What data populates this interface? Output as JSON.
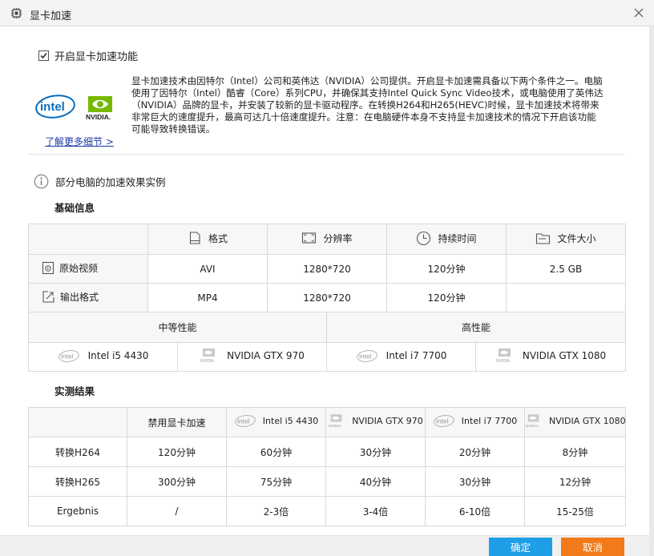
{
  "window": {
    "title": "显卡加速",
    "icon": "app-icon",
    "close_icon": "close-icon"
  },
  "enable": {
    "label": "开启显卡加速功能",
    "checked": true
  },
  "logos": {
    "intel": "intel",
    "nvidia": "NVIDIA."
  },
  "description": "显卡加速技术由因特尔（Intel）公司和英伟达（NVIDIA）公司提供。开启显卡加速需具备以下两个条件之一。电脑使用了因特尔（Intel）酷睿（Core）系列CPU，并确保其支持Intel Quick Sync Video技术，或电脑使用了英伟达（NVIDIA）品牌的显卡，并安装了较新的显卡驱动程序。在转换H264和H265(HEVC)时候，显卡加速技术将带来非常巨大的速度提升，最高可达几十倍速度提升。注意：在电脑硬件本身不支持显卡加速技术的情况下开启该功能可能导致转换错误。",
  "more_link": "了解更多细节 >",
  "info_text": "部分电脑的加速效果实例",
  "basic": {
    "title": "基础信息",
    "headers": [
      "格式",
      "分辨率",
      "持续时间",
      "文件大小"
    ],
    "rows": [
      {
        "label": "原始视频",
        "icon": "video-file-icon",
        "cells": [
          "AVI",
          "1280*720",
          "120分钟",
          "2.5 GB"
        ]
      },
      {
        "label": "输出格式",
        "icon": "export-icon",
        "cells": [
          "MP4",
          "1280*720",
          "120分钟",
          ""
        ]
      }
    ]
  },
  "performance": {
    "mid_label": "中等性能",
    "high_label": "高性能",
    "hardware": [
      "Intel i5 4430",
      "NVIDIA GTX 970",
      "Intel i7 7700",
      "NVIDIA GTX 1080"
    ]
  },
  "results": {
    "title": "实测结果",
    "headers": [
      "禁用显卡加速",
      "Intel i5 4430",
      "NVIDIA GTX 970",
      "Intel i7 7700",
      "NVIDIA GTX 1080"
    ],
    "rows": [
      {
        "label": "转换H264",
        "cells": [
          "120分钟",
          "60分钟",
          "30分钟",
          "20分钟",
          "8分钟"
        ]
      },
      {
        "label": "转换H265",
        "cells": [
          "300分钟",
          "75分钟",
          "40分钟",
          "30分钟",
          "12分钟"
        ]
      },
      {
        "label": "Ergebnis",
        "cells": [
          "/",
          "2-3倍",
          "3-4倍",
          "6-10倍",
          "15-25倍"
        ]
      }
    ]
  },
  "buttons": {
    "ok": "确定",
    "cancel": "取消"
  },
  "colors": {
    "ok": "#1f9ee8",
    "cancel": "#f27a1a",
    "intel": "#0a6ebd",
    "nvidia": "#76b900",
    "link": "#1e3aa8"
  }
}
